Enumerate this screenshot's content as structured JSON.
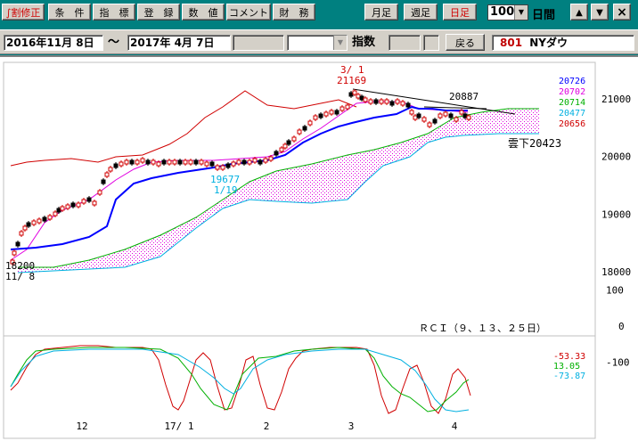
{
  "toolbar": {
    "buttons": [
      "∫割修正",
      "条　件",
      "指　標",
      "登　録",
      "数　値",
      "コメント",
      "財　務"
    ],
    "period_buttons": [
      "月足",
      "週足",
      "日足"
    ],
    "days_value": "100",
    "days_label": "日間",
    "up_arrow": "▲",
    "down_arrow": "▼",
    "close_label": "×"
  },
  "range": {
    "start": "2016年11月 8日",
    "sep": "～",
    "end": "2017年 4月 7日",
    "index_label": "指数",
    "back_button": "戻る",
    "code": "801",
    "name": "NYダウ"
  },
  "chart_data": {
    "type": "line",
    "price_ticks": [
      "21000",
      "20000",
      "19000",
      "18000"
    ],
    "rci_ticks": [
      "100",
      "0",
      "-100"
    ],
    "x_ticks": [
      "12",
      "17/ 1",
      "2",
      "3",
      "4"
    ],
    "right_values": [
      {
        "value": "20726",
        "color": "#0000ff"
      },
      {
        "value": "20702",
        "color": "#e000e0"
      },
      {
        "value": "20714",
        "color": "#00b000"
      },
      {
        "value": "20477",
        "color": "#00b0e0"
      },
      {
        "value": "20656",
        "color": "#d00000"
      }
    ],
    "annotations": {
      "high_date": "3/ 1",
      "high_value": "21169",
      "recent_high": "20887",
      "low_value": "19677",
      "low_date": "1/19",
      "start_value": "18200",
      "start_date": "11/ 8",
      "cloud_label": "雲下20423"
    },
    "rci_title": "ＲＣＩ（９、１３、２５日）",
    "rci_values": [
      {
        "value": "-53.33",
        "color": "#d00000"
      },
      {
        "value": "13.05",
        "color": "#00b000"
      },
      {
        "value": "-73.87",
        "color": "#00b0e0"
      }
    ],
    "colors": {
      "candle_up": "#d00000",
      "candle_down": "#000000",
      "ma_short": "#e000e0",
      "ma_long": "#0000ff",
      "cloud": "#e000e0"
    }
  }
}
